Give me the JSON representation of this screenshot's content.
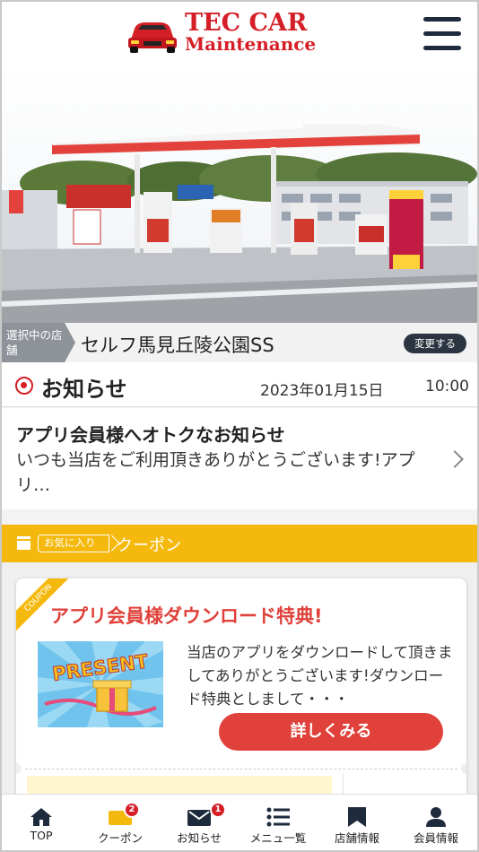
{
  "header": {
    "logo_line1": "TEC CAR",
    "logo_line2": "Maintenance",
    "brand_color": "#d51f27",
    "menu_icon": "hamburger-menu-icon"
  },
  "store": {
    "tag_label": "選択中の店舗",
    "name": "セルフ馬見丘陵公園SS",
    "change_label": "変更する"
  },
  "news": {
    "section_title": "お知らせ",
    "date": "2023年01月15日",
    "time": "10:00",
    "item_title": "アプリ会員様へオトクなお知らせ",
    "item_body": "いつも当店をご利用頂きありがとうございます!アプリ…"
  },
  "coupon_section": {
    "fav_tag": "お気に入り",
    "label": "クーポン",
    "accent_color": "#f5b90d",
    "card": {
      "ribbon": "COUPON",
      "title": "アプリ会員様ダウンロード特典!",
      "body": "当店のアプリをダウンロードして頂きましてありがとうございます!ダウンロード特典としまして・・・",
      "detail_button": "詳しくみる",
      "image_text": "PRESENT"
    }
  },
  "bottom_nav": {
    "items": [
      {
        "label": "TOP",
        "icon": "home-icon"
      },
      {
        "label": "クーポン",
        "icon": "coupon-icon",
        "badge": "2"
      },
      {
        "label": "お知らせ",
        "icon": "mail-icon",
        "badge": "1"
      },
      {
        "label": "メニュ一覧",
        "icon": "list-icon"
      },
      {
        "label": "店舗情報",
        "icon": "store-icon"
      },
      {
        "label": "会員情報",
        "icon": "person-icon"
      }
    ]
  }
}
